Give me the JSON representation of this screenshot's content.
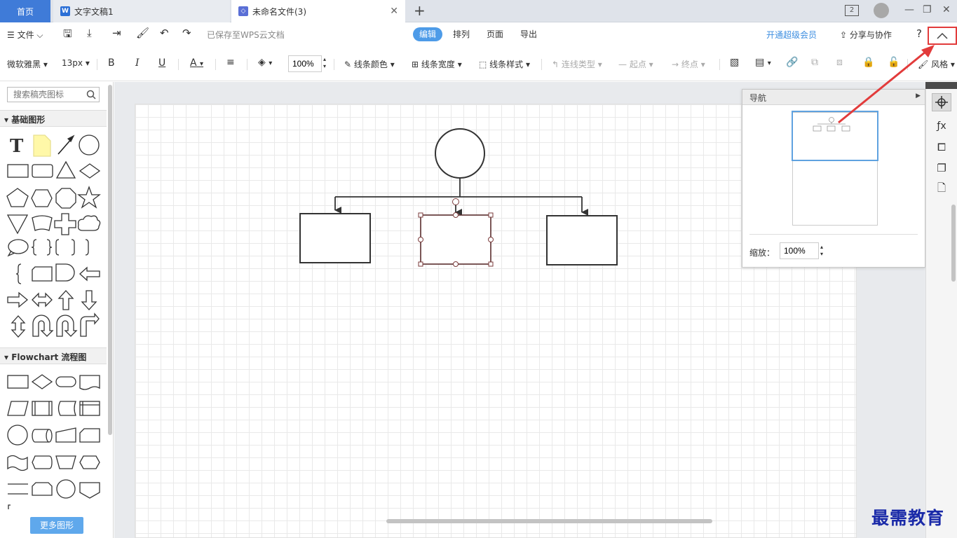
{
  "tabs": {
    "home": "首页",
    "doc": "文字文稿1",
    "file": "未命名文件(3)",
    "add_icon": "plus-icon",
    "badge_count": "2"
  },
  "menubar": {
    "file_menu": "文件",
    "save_status": "已保存至WPS云文档",
    "modes": [
      "编辑",
      "排列",
      "页面",
      "导出"
    ],
    "vip": "开通超级会员",
    "share": "分享与协作",
    "help": "?"
  },
  "toolbar": {
    "font_family": "微软雅黑",
    "font_size": "13px",
    "bold": "B",
    "italic": "I",
    "underline": "U",
    "font_color": "A",
    "zoom": "100%",
    "line_color": "线条颜色",
    "line_width": "线条宽度",
    "line_style": "线条样式",
    "connector_type": "连线类型",
    "start_point": "起点",
    "end_point": "终点",
    "style": "风格"
  },
  "sidebar": {
    "search_placeholder": "搜索稿壳图标",
    "category_basic": "基础图形",
    "category_flowchart": "Flowchart 流程图",
    "more_shapes": "更多图形"
  },
  "nav_panel": {
    "title": "导航",
    "zoom_label": "缩放：",
    "zoom_value": "100%"
  },
  "watermark": "最需教育",
  "colors": {
    "accent": "#4d9be8",
    "home_tab": "#3f7bd8",
    "highlight": "#e23b3b",
    "selection": "#7a3a3a"
  }
}
